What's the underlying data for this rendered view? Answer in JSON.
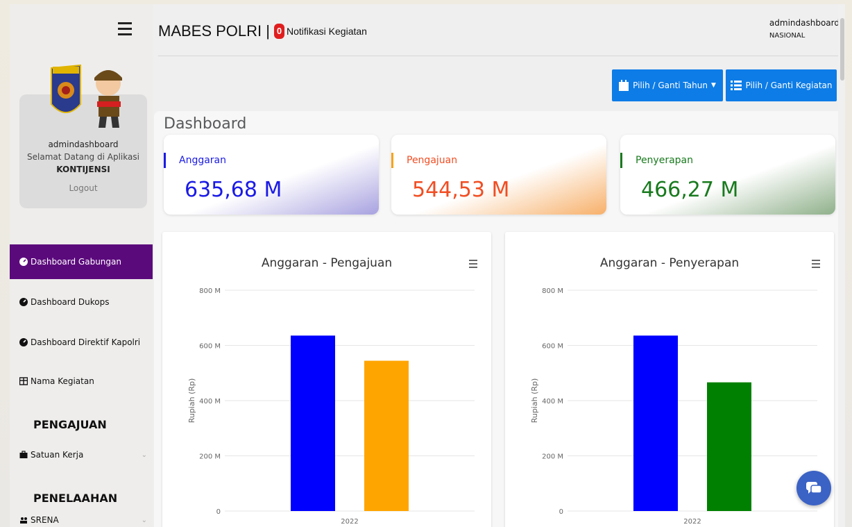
{
  "topbar": {
    "brand": "MABES POLRI |",
    "notif_count": "0",
    "notif_label": "Notifikasi Kegiatan",
    "user": "admindashboard",
    "role": "NASIONAL"
  },
  "profile": {
    "name": "admindashboard",
    "welcome": "Selamat Datang di Aplikasi",
    "app": "KONTIJENSI",
    "logout": "Logout"
  },
  "sidebar": {
    "items": [
      {
        "label": "Dashboard Gabungan",
        "icon": "gauge-icon",
        "active": true
      },
      {
        "label": "Dashboard Dukops",
        "icon": "gauge-icon",
        "active": false
      },
      {
        "label": "Dashboard Direktif Kapolri",
        "icon": "gauge-icon",
        "active": false
      },
      {
        "label": "Nama Kegiatan",
        "icon": "table-icon",
        "active": false
      }
    ],
    "heading_pengajuan": "PENGAJUAN",
    "satuan_kerja": "Satuan Kerja",
    "heading_penelaahan": "PENELAAHAN",
    "srena": "SRENA"
  },
  "toolbar": {
    "year_button": "Pilih / Ganti Tahun",
    "activity_button": "Pilih / Ganti Kegiatan"
  },
  "page": {
    "title": "Dashboard"
  },
  "stats": [
    {
      "label": "Anggaran",
      "value": "635,68 M",
      "color": "#1a1ae6"
    },
    {
      "label": "Pengajuan",
      "value": "544,53 M",
      "color": "#f04e23"
    },
    {
      "label": "Penyerapan",
      "value": "466,27 M",
      "color": "#197a1e"
    }
  ],
  "colors": {
    "active_nav": "#5b0a7c",
    "button": "#0d7ce6",
    "anggaran": "#0000ff",
    "pengajuan": "#ffa500",
    "penyerapan": "#008000"
  },
  "chart_data": [
    {
      "type": "bar",
      "title": "Anggaran - Pengajuan",
      "ylabel": "Rupiah (Rp)",
      "categories": [
        "2022"
      ],
      "yticks": [
        "0",
        "200 M",
        "400 M",
        "600 M",
        "800 M"
      ],
      "ylim": [
        0,
        800
      ],
      "series": [
        {
          "values": [
            635.68
          ],
          "color": "#0000ff"
        },
        {
          "values": [
            544.53
          ],
          "color": "#ffa500"
        }
      ]
    },
    {
      "type": "bar",
      "title": "Anggaran - Penyerapan",
      "ylabel": "Rupiah (Rp)",
      "categories": [
        "2022"
      ],
      "yticks": [
        "0",
        "200 M",
        "400 M",
        "600 M",
        "800 M"
      ],
      "ylim": [
        0,
        800
      ],
      "series": [
        {
          "values": [
            635.68
          ],
          "color": "#0000ff"
        },
        {
          "values": [
            466.27
          ],
          "color": "#008000"
        }
      ]
    }
  ]
}
